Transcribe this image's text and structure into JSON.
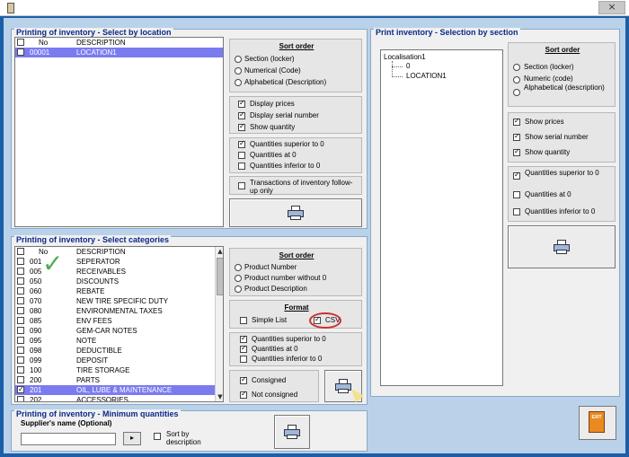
{
  "window": {
    "close_label": "×"
  },
  "location_group": {
    "title": "Printing of inventory - Select by location",
    "columns": {
      "no": "No",
      "description": "DESCRIPTION"
    },
    "rows": [
      {
        "no": "00001",
        "description": "LOCATION1",
        "selected": true
      }
    ],
    "sort": {
      "title": "Sort order",
      "options": [
        "Section (locker)",
        "Numerical (Code)",
        "Alphabetical (Description)"
      ]
    },
    "display": [
      "Display prices",
      "Display serial number",
      "Show quantity"
    ],
    "quantities": [
      "Quantities superior to 0",
      "Quantities at 0",
      "Quantities inferior to 0"
    ],
    "transactions_label": "Transactions of inventory follow-up only"
  },
  "categories_group": {
    "title": "Printing of inventory - Select categories",
    "columns": {
      "no": "No",
      "description": "DESCRIPTION"
    },
    "rows": [
      {
        "no": "001",
        "description": "SEPERATOR",
        "checked": false,
        "selected": false
      },
      {
        "no": "005",
        "description": "RECEIVABLES",
        "checked": false,
        "selected": false
      },
      {
        "no": "050",
        "description": "DISCOUNTS",
        "checked": false,
        "selected": false
      },
      {
        "no": "060",
        "description": "REBATE",
        "checked": false,
        "selected": false
      },
      {
        "no": "070",
        "description": "NEW TIRE SPECIFIC DUTY",
        "checked": false,
        "selected": false
      },
      {
        "no": "080",
        "description": "ENVIRONMENTAL TAXES",
        "checked": false,
        "selected": false
      },
      {
        "no": "085",
        "description": "ENV FEES",
        "checked": false,
        "selected": false
      },
      {
        "no": "090",
        "description": "GEM-CAR NOTES",
        "checked": false,
        "selected": false
      },
      {
        "no": "095",
        "description": "NOTE",
        "checked": false,
        "selected": false
      },
      {
        "no": "098",
        "description": "DEDUCTIBLE",
        "checked": false,
        "selected": false
      },
      {
        "no": "099",
        "description": "DEPOSIT",
        "checked": false,
        "selected": false
      },
      {
        "no": "100",
        "description": "TIRE STORAGE",
        "checked": false,
        "selected": false
      },
      {
        "no": "200",
        "description": "PARTS",
        "checked": false,
        "selected": false
      },
      {
        "no": "201",
        "description": "OIL, LUBE & MAINTENANCE",
        "checked": true,
        "selected": true
      },
      {
        "no": "202",
        "description": "ACCESSORIES",
        "checked": false,
        "selected": false
      }
    ],
    "sort": {
      "title": "Sort order",
      "options": [
        "Product Number",
        "Product number without 0",
        "Product Description"
      ]
    },
    "format": {
      "title": "Format",
      "simple_list": "Simple List",
      "csv": "CSV"
    },
    "quantities": [
      "Quantities superior to 0",
      "Quantities at 0",
      "Quantities inferior to 0"
    ],
    "consigned": [
      "Consigned",
      "Not consigned"
    ]
  },
  "minimum_group": {
    "title": "Printing of inventory - Minimum quantities",
    "supplier_label": "Supplier's name (Optional)",
    "supplier_value": "",
    "sort_by_description": "Sort by description"
  },
  "section_group": {
    "title": "Print inventory - Selection by section",
    "tree": {
      "root": "Localisation1",
      "child1": "0",
      "child2": "LOCATION1"
    },
    "sort": {
      "title": "Sort order",
      "options": [
        "Section (locker)",
        "Numeric (code)",
        "Alphabetical (description)"
      ]
    },
    "display": [
      "Show prices",
      "Show serial number",
      "Show quantity"
    ],
    "quantities": [
      "Quantities superior to 0",
      "Quantities at 0",
      "Quantities inferior to 0"
    ]
  },
  "exit_button": {
    "icon_text": "EXIT"
  }
}
